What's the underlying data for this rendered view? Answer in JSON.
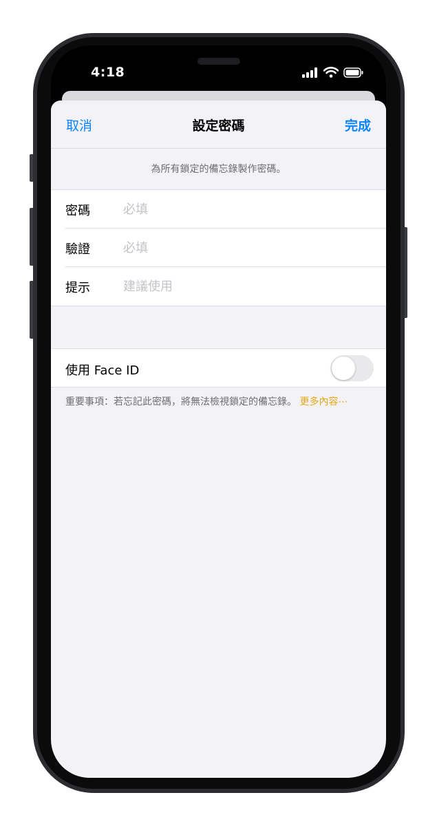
{
  "status_bar": {
    "time": "4:18"
  },
  "nav": {
    "cancel_label": "取消",
    "title": "設定密碼",
    "done_label": "完成"
  },
  "description": "為所有鎖定的備忘錄製作密碼。",
  "form": {
    "rows": [
      {
        "label": "密碼",
        "placeholder": "必填",
        "value": ""
      },
      {
        "label": "驗證",
        "placeholder": "必填",
        "value": ""
      },
      {
        "label": "提示",
        "placeholder": "建議使用",
        "value": ""
      }
    ]
  },
  "face_id": {
    "label": "使用 Face ID",
    "enabled": false
  },
  "footnote": {
    "text": "重要事項：若忘記此密碼，將無法檢視鎖定的備忘錄。",
    "link": "更多內容⋯"
  },
  "colors": {
    "accent": "#0a84ff",
    "link": "#e6a817",
    "background": "#f2f2f7"
  }
}
